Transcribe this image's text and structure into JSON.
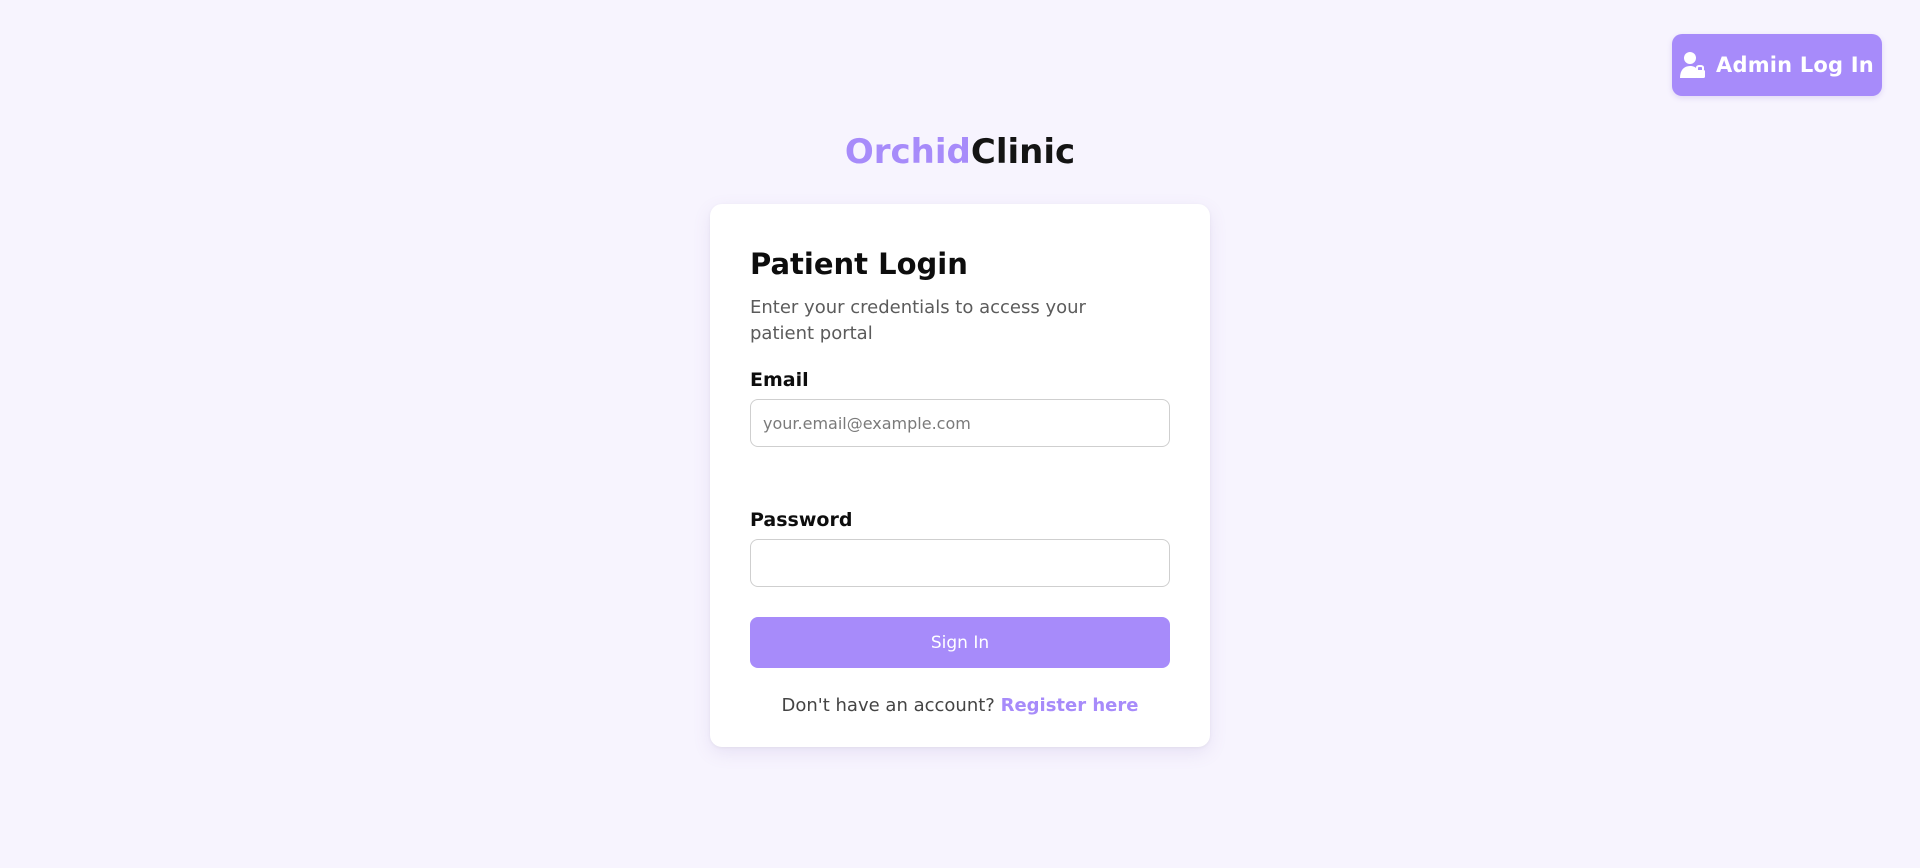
{
  "header": {
    "admin_button_label": "Admin Log In",
    "admin_icon": "user-lock-icon"
  },
  "brand": {
    "part1": "Orchid",
    "part2": "Clinic"
  },
  "login": {
    "title": "Patient Login",
    "subtitle": "Enter your credentials to access your patient portal",
    "email_label": "Email",
    "email_placeholder": "your.email@example.com",
    "email_value": "",
    "password_label": "Password",
    "password_value": "",
    "signin_label": "Sign In",
    "register_prompt": "Don't have an account?",
    "register_link": "Register here"
  },
  "colors": {
    "accent": "#a78bfa",
    "background": "#f7f4fe",
    "text": "#0d0d0d",
    "muted": "#5b5b5b"
  }
}
